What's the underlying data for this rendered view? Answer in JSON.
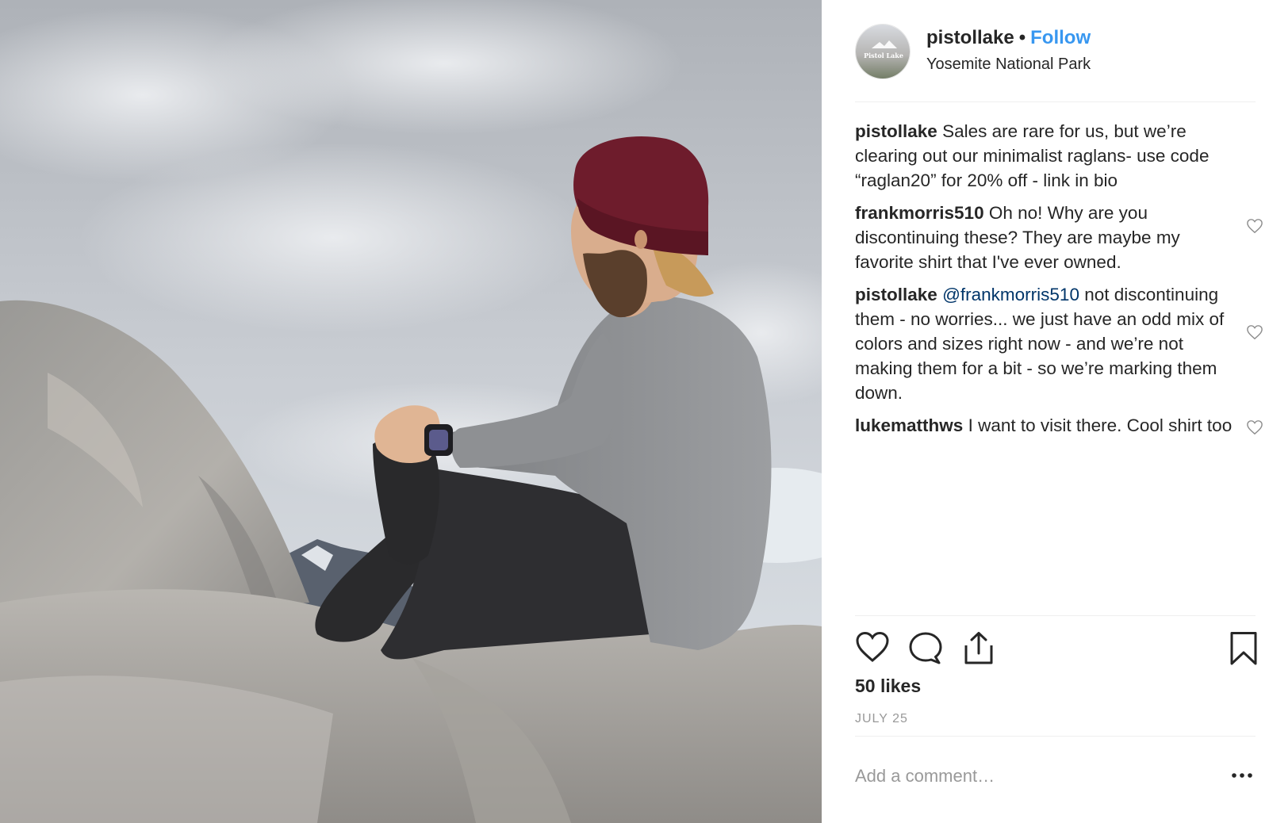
{
  "header": {
    "username": "pistollake",
    "separator": "•",
    "follow_label": "Follow",
    "location": "Yosemite National Park",
    "avatar_text": "Pistol Lake"
  },
  "comments": [
    {
      "user": "pistollake",
      "text": "Sales are rare for us, but we’re clearing out our minimalist raglans- use code “raglan20” for 20% off - link in bio",
      "mention": "",
      "likeable": false
    },
    {
      "user": "frankmorris510",
      "text": "Oh no! Why are you discontinuing these? They are maybe my favorite shirt that I've ever owned.",
      "mention": "",
      "likeable": true
    },
    {
      "user": "pistollake",
      "mention": "@frankmorris510",
      "text": "not discontinuing them - no worries... we just have an odd mix of colors and sizes right now - and we’re not making them for a bit - so we’re marking them down.",
      "likeable": true
    },
    {
      "user": "lukematthws",
      "text": "I want to visit there. Cool shirt too",
      "mention": "",
      "likeable": true
    }
  ],
  "actions": {
    "icons": [
      "heart-icon",
      "comment-icon",
      "share-icon",
      "bookmark-icon"
    ]
  },
  "likes_label": "50 likes",
  "date_label": "JULY 25",
  "add_comment": {
    "placeholder": "Add a comment…",
    "value": ""
  },
  "more_icon": "more-options-icon",
  "colors": {
    "follow": "#3897f0",
    "mention": "#003569",
    "muted": "#999999",
    "text": "#262626"
  }
}
